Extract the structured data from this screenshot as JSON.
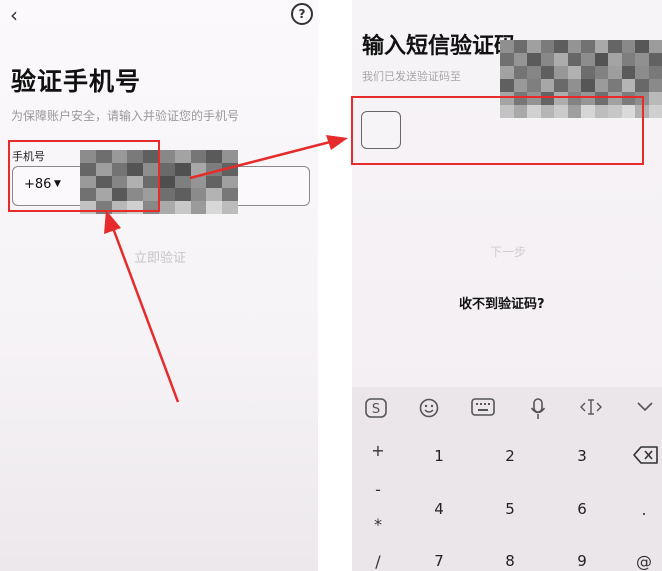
{
  "left_screen": {
    "title": "验证手机号",
    "subtitle": "为保障账户安全，请输入并验证您的手机号",
    "phone_label": "手机号",
    "country_code": "+86",
    "verify_button": "立即验证"
  },
  "right_screen": {
    "title": "输入短信验证码",
    "subtitle": "我们已发送验证码至",
    "next_button": "下一步",
    "no_code_link": "收不到验证码?"
  },
  "keyboard": {
    "symbol_keys": [
      "+",
      "-",
      "*",
      "/"
    ],
    "digit_row1": [
      "1",
      "2",
      "3"
    ],
    "digit_row2": [
      "4",
      "5",
      "6"
    ],
    "digit_row3": [
      "7",
      "8",
      "9"
    ],
    "right_keys": [
      ".",
      "@"
    ]
  },
  "icons": {
    "back": "chevron-left-icon",
    "help": "help-circle-icon",
    "country_dropdown": "caret-down-icon",
    "keyboard_logo": "sogou-logo-icon",
    "emoji": "emoji-icon",
    "keyboard_switch": "keyboard-icon",
    "voice": "microphone-icon",
    "cursor_move": "cursor-move-icon",
    "collapse": "chevron-down-icon",
    "delete": "backspace-icon"
  },
  "colors": {
    "annotation_red": "#e62b2b",
    "title_text": "#111111",
    "muted_text": "#9a9a9a"
  }
}
